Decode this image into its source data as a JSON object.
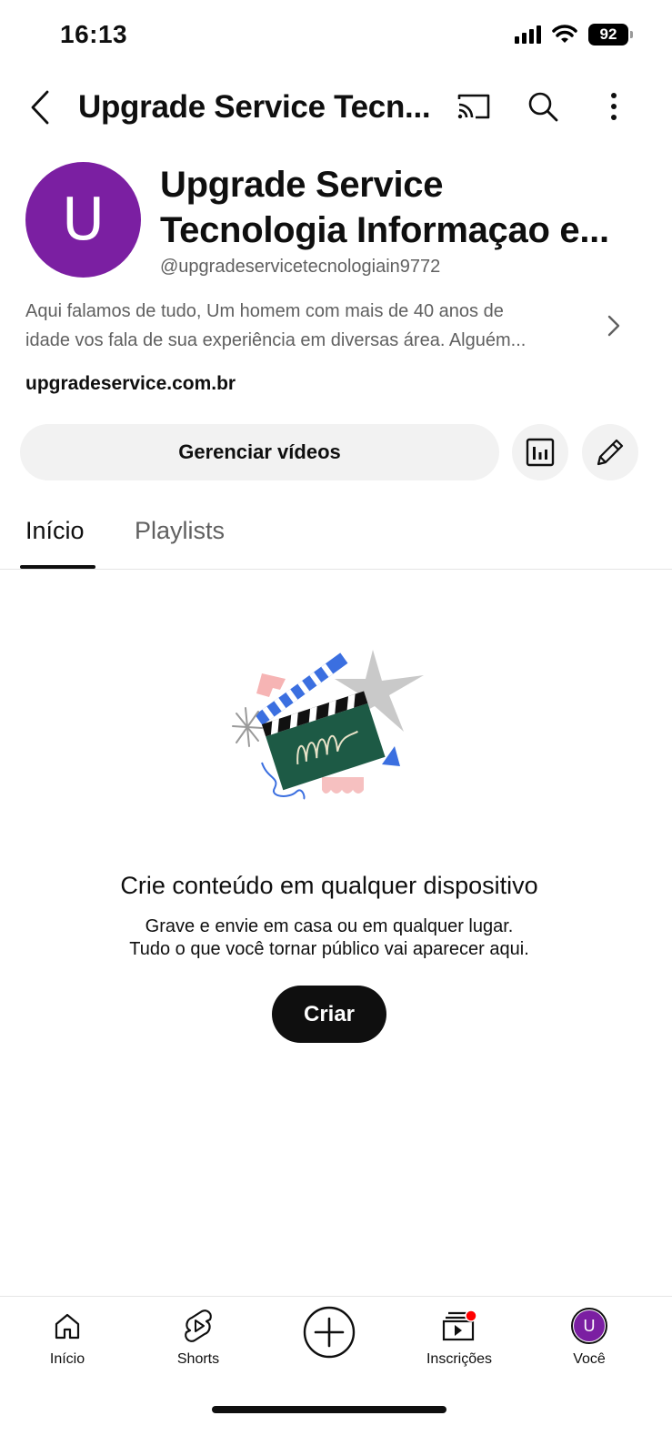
{
  "status_bar": {
    "time": "16:13",
    "battery": "92"
  },
  "app_bar": {
    "title": "Upgrade Service Tecn..."
  },
  "channel": {
    "avatar_letter": "U",
    "name_line1": "Upgrade Service",
    "name_line2": "Tecnologia Informaçao e...",
    "handle": "@upgradeservicetecnologiain9772",
    "description_line1": "Aqui falamos de tudo, Um homem com mais de 40 anos de",
    "description_line2": "idade vos fala de sua experiência em diversas área. Alguém...",
    "website": "upgradeservice.com.br"
  },
  "actions": {
    "manage_label": "Gerenciar vídeos"
  },
  "tabs": [
    {
      "label": "Início",
      "active": true
    },
    {
      "label": "Playlists",
      "active": false
    }
  ],
  "empty_state": {
    "title": "Crie conteúdo em qualquer dispositivo",
    "subtitle_line1": "Grave e envie em casa ou em qualquer lugar.",
    "subtitle_line2": "Tudo o que você tornar público vai aparecer aqui.",
    "button_label": "Criar"
  },
  "bottom_nav": {
    "home": "Início",
    "shorts": "Shorts",
    "subscriptions": "Inscrições",
    "you": "Você",
    "you_avatar_letter": "U"
  },
  "colors": {
    "avatar": "#7b1fa2",
    "notification_dot": "#ff0000"
  }
}
